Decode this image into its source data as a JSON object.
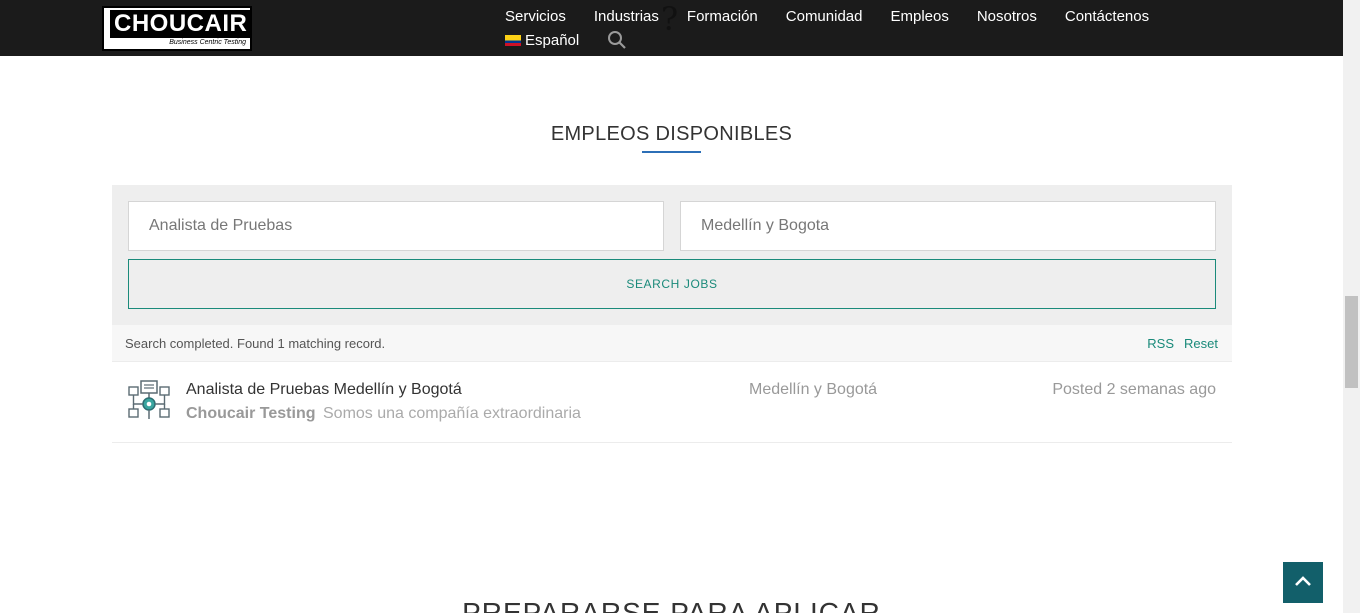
{
  "header": {
    "logo": {
      "main": "CHOUCAIR",
      "sub": "Business Centric Testing"
    },
    "nav": [
      {
        "label": "Servicios"
      },
      {
        "label": "Industrias"
      },
      {
        "label": "Formación"
      },
      {
        "label": "Comunidad"
      },
      {
        "label": "Empleos"
      },
      {
        "label": "Nosotros"
      },
      {
        "label": "Contáctenos"
      }
    ],
    "language": "Español",
    "flag": "colombia-flag",
    "search_icon": "search-icon",
    "overlay_glyph": "?"
  },
  "section": {
    "title": "EMPLEOS DISPONIBLES",
    "accent": "#2c6fb7"
  },
  "search": {
    "keyword_value": "Analista de Pruebas",
    "location_value": "Medellín y Bogota",
    "button_label": "SEARCH JOBS",
    "accent": "#1a8a7a"
  },
  "status": {
    "text": "Search completed. Found 1 matching record.",
    "rss_label": "RSS",
    "reset_label": "Reset"
  },
  "jobs": [
    {
      "title": "Analista de Pruebas Medellín y Bogotá",
      "company": "Choucair Testing",
      "tagline": "Somos una compañía extraordinaria",
      "location": "Medellín y Bogotá",
      "posted": "Posted 2 semanas ago",
      "logo_icon": "network-diagram-icon"
    }
  ],
  "next_section": {
    "title": "PREPARARSE PARA APLICAR"
  },
  "back_to_top": {
    "icon": "chevron-up-icon",
    "color": "#125f6a"
  }
}
